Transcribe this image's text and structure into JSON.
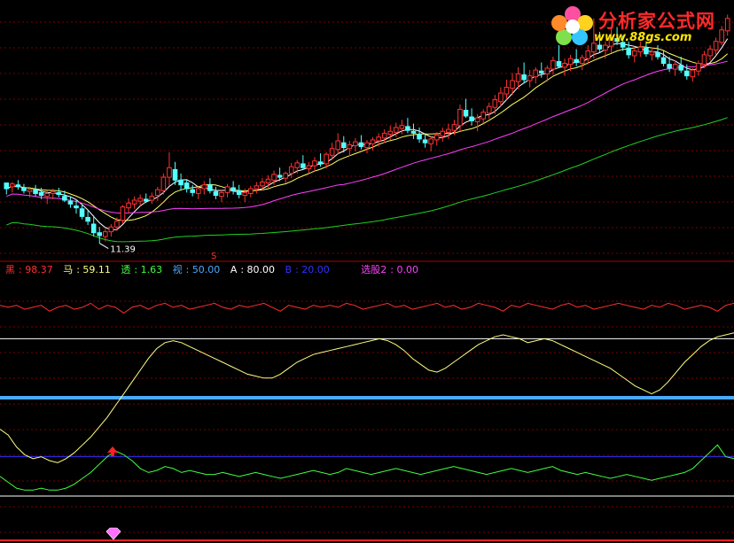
{
  "logo": {
    "brand": "分析家公式网",
    "url": "www.88gs.com"
  },
  "legend": {
    "items": [
      {
        "label": "黑",
        "value": "98.37",
        "color": "#ff3030"
      },
      {
        "label": "马",
        "value": "59.11",
        "color": "#ffff80"
      },
      {
        "label": "透",
        "value": "1.63",
        "color": "#40ff40"
      },
      {
        "label": "视",
        "value": "50.00",
        "color": "#4aa8ff"
      },
      {
        "label": "A",
        "value": "80.00",
        "color": "#ffffff"
      },
      {
        "label": "B",
        "value": "20.00",
        "color": "#3030ff"
      },
      {
        "label": "选股2",
        "value": "0.00",
        "color": "#ff40ff"
      }
    ]
  },
  "annotations": {
    "low_price": "11.39",
    "signal": "S"
  },
  "chart_data": [
    {
      "type": "candlestick",
      "panel": "price",
      "min_label": "11.39",
      "ma_colors": [
        "#ffffff",
        "#ffff60",
        "#ff40ff",
        "#20d020"
      ],
      "candles": [
        [
          118,
          118,
          106,
          112
        ],
        [
          114,
          119,
          108,
          117
        ],
        [
          116,
          121,
          111,
          114
        ],
        [
          113,
          117,
          107,
          110
        ],
        [
          109,
          114,
          103,
          111
        ],
        [
          111,
          116,
          104,
          107
        ],
        [
          108,
          113,
          101,
          105
        ],
        [
          104,
          110,
          96,
          107
        ],
        [
          107,
          112,
          101,
          109
        ],
        [
          108,
          113,
          103,
          106
        ],
        [
          104,
          110,
          98,
          100
        ],
        [
          99,
          104,
          92,
          96
        ],
        [
          94,
          100,
          86,
          92
        ],
        [
          91,
          96,
          80,
          83
        ],
        [
          82,
          90,
          74,
          78
        ],
        [
          75,
          84,
          62,
          66
        ],
        [
          66,
          72,
          55,
          63
        ],
        [
          62,
          70,
          57,
          67
        ],
        [
          67,
          75,
          62,
          72
        ],
        [
          72,
          82,
          68,
          78
        ],
        [
          79,
          95,
          75,
          93
        ],
        [
          92,
          102,
          86,
          97
        ],
        [
          96,
          104,
          91,
          100
        ],
        [
          99,
          106,
          94,
          102
        ],
        [
          101,
          107,
          97,
          99
        ],
        [
          100,
          108,
          96,
          104
        ],
        [
          105,
          114,
          99,
          111
        ],
        [
          110,
          128,
          106,
          124
        ],
        [
          124,
          150,
          115,
          134
        ],
        [
          132,
          140,
          116,
          121
        ],
        [
          121,
          128,
          110,
          116
        ],
        [
          118,
          122,
          108,
          112
        ],
        [
          111,
          116,
          104,
          108
        ],
        [
          107,
          114,
          101,
          112
        ],
        [
          112,
          120,
          106,
          116
        ],
        [
          116,
          123,
          107,
          110
        ],
        [
          109,
          114,
          101,
          105
        ],
        [
          104,
          111,
          98,
          108
        ],
        [
          108,
          117,
          103,
          114
        ],
        [
          113,
          120,
          106,
          110
        ],
        [
          110,
          116,
          102,
          106
        ],
        [
          105,
          112,
          98,
          108
        ],
        [
          107,
          115,
          103,
          112
        ],
        [
          112,
          119,
          107,
          115
        ],
        [
          115,
          123,
          110,
          119
        ],
        [
          118,
          126,
          113,
          122
        ],
        [
          121,
          131,
          116,
          127
        ],
        [
          126,
          134,
          120,
          124
        ],
        [
          123,
          130,
          118,
          128
        ],
        [
          128,
          139,
          123,
          135
        ],
        [
          134,
          142,
          128,
          139
        ],
        [
          138,
          147,
          132,
          134
        ],
        [
          133,
          140,
          128,
          136
        ],
        [
          136,
          145,
          130,
          141
        ],
        [
          140,
          149,
          135,
          138
        ],
        [
          138,
          150,
          133,
          148
        ],
        [
          147,
          160,
          142,
          154
        ],
        [
          153,
          170,
          148,
          162
        ],
        [
          160,
          167,
          150,
          155
        ],
        [
          154,
          162,
          146,
          158
        ],
        [
          157,
          165,
          151,
          161
        ],
        [
          160,
          168,
          153,
          156
        ],
        [
          155,
          163,
          149,
          160
        ],
        [
          159,
          166,
          152,
          163
        ],
        [
          162,
          170,
          156,
          166
        ],
        [
          165,
          174,
          160,
          170
        ],
        [
          169,
          178,
          163,
          172
        ],
        [
          171,
          181,
          166,
          176
        ],
        [
          175,
          184,
          169,
          178
        ],
        [
          177,
          186,
          170,
          173
        ],
        [
          172,
          180,
          164,
          170
        ],
        [
          169,
          176,
          160,
          164
        ],
        [
          163,
          170,
          155,
          160
        ],
        [
          159,
          167,
          151,
          164
        ],
        [
          163,
          171,
          157,
          168
        ],
        [
          167,
          176,
          161,
          172
        ],
        [
          171,
          180,
          164,
          174
        ],
        [
          173,
          184,
          168,
          179
        ],
        [
          178,
          200,
          172,
          195
        ],
        [
          194,
          206,
          186,
          188
        ],
        [
          187,
          196,
          178,
          183
        ],
        [
          182,
          190,
          172,
          186
        ],
        [
          185,
          195,
          180,
          192
        ],
        [
          191,
          202,
          185,
          198
        ],
        [
          197,
          210,
          190,
          205
        ],
        [
          203,
          218,
          198,
          212
        ],
        [
          211,
          226,
          205,
          218
        ],
        [
          217,
          233,
          210,
          225
        ],
        [
          224,
          239,
          216,
          232
        ],
        [
          231,
          244,
          222,
          226
        ],
        [
          225,
          236,
          218,
          230
        ],
        [
          229,
          239,
          222,
          236
        ],
        [
          235,
          244,
          228,
          233
        ],
        [
          232,
          241,
          224,
          238
        ],
        [
          237,
          250,
          231,
          246
        ],
        [
          245,
          262,
          238,
          240
        ],
        [
          239,
          248,
          230,
          243
        ],
        [
          242,
          252,
          235,
          248
        ],
        [
          247,
          258,
          240,
          244
        ],
        [
          243,
          252,
          236,
          249
        ],
        [
          248,
          262,
          242,
          256
        ],
        [
          255,
          290,
          248,
          264
        ],
        [
          262,
          276,
          254,
          258
        ],
        [
          257,
          266,
          248,
          262
        ],
        [
          261,
          280,
          254,
          270
        ],
        [
          269,
          281,
          262,
          266
        ],
        [
          265,
          272,
          256,
          260
        ],
        [
          259,
          266,
          248,
          252
        ],
        [
          251,
          260,
          244,
          256
        ],
        [
          255,
          266,
          250,
          260
        ],
        [
          259,
          266,
          250,
          253
        ],
        [
          252,
          260,
          246,
          255
        ],
        [
          254,
          262,
          247,
          250
        ],
        [
          249,
          256,
          240,
          243
        ],
        [
          242,
          250,
          234,
          238
        ],
        [
          237,
          246,
          230,
          242
        ],
        [
          241,
          250,
          233,
          236
        ],
        [
          235,
          242,
          226,
          230
        ],
        [
          229,
          238,
          224,
          236
        ],
        [
          235,
          246,
          230,
          243
        ],
        [
          242,
          256,
          238,
          252
        ],
        [
          251,
          262,
          246,
          258
        ],
        [
          257,
          270,
          252,
          266
        ],
        [
          265,
          282,
          262,
          278
        ],
        [
          277,
          294,
          272,
          290
        ]
      ]
    },
    {
      "type": "line",
      "panel": "indicator",
      "ylim": [
        0,
        100
      ],
      "reference_lines": [
        {
          "name": "A",
          "value": 80,
          "color": "#ffffff"
        },
        {
          "name": "B",
          "value": 20,
          "color": "#3030ff"
        },
        {
          "name": "视",
          "value": 50,
          "color": "#4aa8ff"
        },
        {
          "value": 0,
          "color": "#ffffff"
        }
      ],
      "series": [
        {
          "name": "黑",
          "color": "#ff3030",
          "values": [
            97,
            96,
            97,
            95,
            96,
            97,
            94,
            96,
            97,
            95,
            96,
            98,
            95,
            97,
            96,
            93,
            96,
            97,
            95,
            97,
            98,
            96,
            97,
            95,
            96,
            97,
            98,
            96,
            95,
            97,
            96,
            97,
            98,
            96,
            94,
            97,
            96,
            95,
            97,
            96,
            97,
            96,
            98,
            97,
            95,
            96,
            97,
            98,
            96,
            97,
            95,
            96,
            97,
            98,
            96,
            97,
            95,
            96,
            98,
            97,
            96,
            94,
            97,
            96,
            98,
            97,
            96,
            95,
            97,
            98,
            96,
            97,
            95,
            96,
            97,
            98,
            97,
            96,
            95,
            97,
            96,
            98,
            97,
            95,
            96,
            97,
            96,
            94,
            97,
            98
          ]
        },
        {
          "name": "马",
          "color": "#ffff80",
          "values": [
            34,
            31,
            25,
            21,
            19,
            20,
            18,
            17,
            19,
            22,
            26,
            30,
            35,
            40,
            46,
            52,
            58,
            64,
            70,
            75,
            78,
            79,
            78,
            76,
            74,
            72,
            70,
            68,
            66,
            64,
            62,
            61,
            60,
            60,
            62,
            65,
            68,
            70,
            72,
            73,
            74,
            75,
            76,
            77,
            78,
            79,
            80,
            79,
            77,
            74,
            70,
            67,
            64,
            63,
            65,
            68,
            71,
            74,
            77,
            79,
            81,
            82,
            81,
            80,
            78,
            79,
            80,
            79,
            77,
            75,
            73,
            71,
            69,
            67,
            65,
            62,
            59,
            56,
            54,
            52,
            54,
            58,
            63,
            68,
            72,
            76,
            79,
            81,
            82,
            83
          ]
        },
        {
          "name": "透",
          "color": "#40ff40",
          "values": [
            10,
            7,
            4,
            3,
            3,
            4,
            3,
            3,
            4,
            6,
            9,
            12,
            16,
            20,
            23,
            21,
            18,
            14,
            12,
            13,
            15,
            14,
            12,
            13,
            12,
            11,
            11,
            12,
            11,
            10,
            11,
            12,
            11,
            10,
            9,
            10,
            11,
            12,
            13,
            12,
            11,
            12,
            14,
            13,
            12,
            11,
            12,
            13,
            14,
            13,
            12,
            11,
            12,
            13,
            14,
            15,
            14,
            13,
            12,
            11,
            12,
            13,
            14,
            13,
            12,
            13,
            14,
            15,
            13,
            12,
            11,
            12,
            11,
            10,
            9,
            10,
            11,
            10,
            9,
            8,
            9,
            10,
            11,
            12,
            14,
            18,
            22,
            26,
            20,
            19
          ]
        },
        {
          "name": "选股2",
          "color": "#ff40ff",
          "values": []
        }
      ]
    }
  ]
}
